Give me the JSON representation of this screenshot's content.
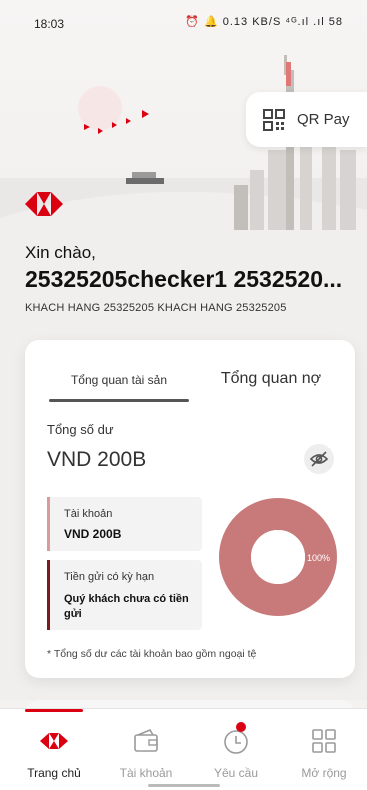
{
  "status_bar": {
    "time": "18:03",
    "icons_text": "⏰ 🔔 0.13 KB/S ⁴ᴳ.ıl .ıl 58"
  },
  "qr_pay": {
    "label": "QR Pay"
  },
  "greeting": "Xin chào,",
  "user": {
    "name": "25325205checker1 2532520...",
    "subtitle": "KHACH HANG 25325205 KHACH HANG 25325205"
  },
  "overview": {
    "tabs": [
      {
        "label": "Tổng quan tài sản",
        "active": true
      },
      {
        "label": "Tổng quan nợ",
        "active": false
      }
    ],
    "total_label": "Tổng số dư",
    "total_value": "VND 200B",
    "accounts": {
      "label": "Tài khoản",
      "value": "VND 200B",
      "color": "#d89a9a"
    },
    "deposits": {
      "label": "Tiền gửi có kỳ hạn",
      "value": "Quý khách chưa có tiền gửi",
      "color": "#7a1a1e"
    },
    "donut": {
      "percent_label": "100%",
      "accounts_share": 1.0,
      "color": "#c87a7a"
    },
    "note": "* Tổng số dư các tài khoản bao gồm ngoại tệ"
  },
  "bottom_nav": [
    {
      "label": "Trang chủ",
      "icon": "hexagon-logo-icon",
      "active": true
    },
    {
      "label": "Tài khoản",
      "icon": "wallet-icon",
      "active": false
    },
    {
      "label": "Yêu cầu",
      "icon": "clock-icon",
      "active": false
    },
    {
      "label": "Mở rộng",
      "icon": "grid-icon",
      "active": false
    }
  ],
  "colors": {
    "brand_red": "#db0011",
    "text_dark": "#1f1f1f",
    "muted": "#9a9a9a"
  }
}
